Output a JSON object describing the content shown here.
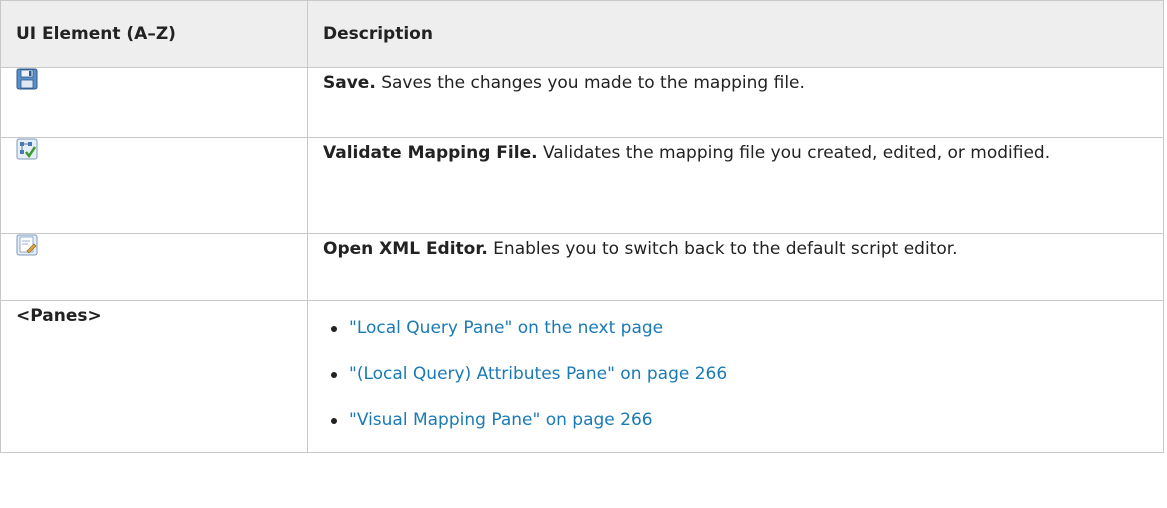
{
  "header": {
    "col_element": "UI Element (A–Z)",
    "col_description": "Description"
  },
  "rows": [
    {
      "icon": "save-disk-icon",
      "term": "Save.",
      "text": " Saves the changes you made to the mapping file."
    },
    {
      "icon": "validate-mapping-icon",
      "term": "Validate Mapping File.",
      "text": " Validates the mapping file you created, edited, or modified."
    },
    {
      "icon": "xml-editor-icon",
      "term": "Open XML Editor.",
      "text": " Enables you to switch back to the default script editor."
    }
  ],
  "panes": {
    "label": "<Panes>",
    "links": [
      "\"Local Query Pane\" on the next page",
      "\"(Local Query) Attributes Pane\" on page 266",
      "\"Visual Mapping Pane\" on page 266"
    ]
  },
  "colors": {
    "link": "#1a7ab5",
    "header_bg": "#eeeeee",
    "border": "#c8c8c8"
  }
}
